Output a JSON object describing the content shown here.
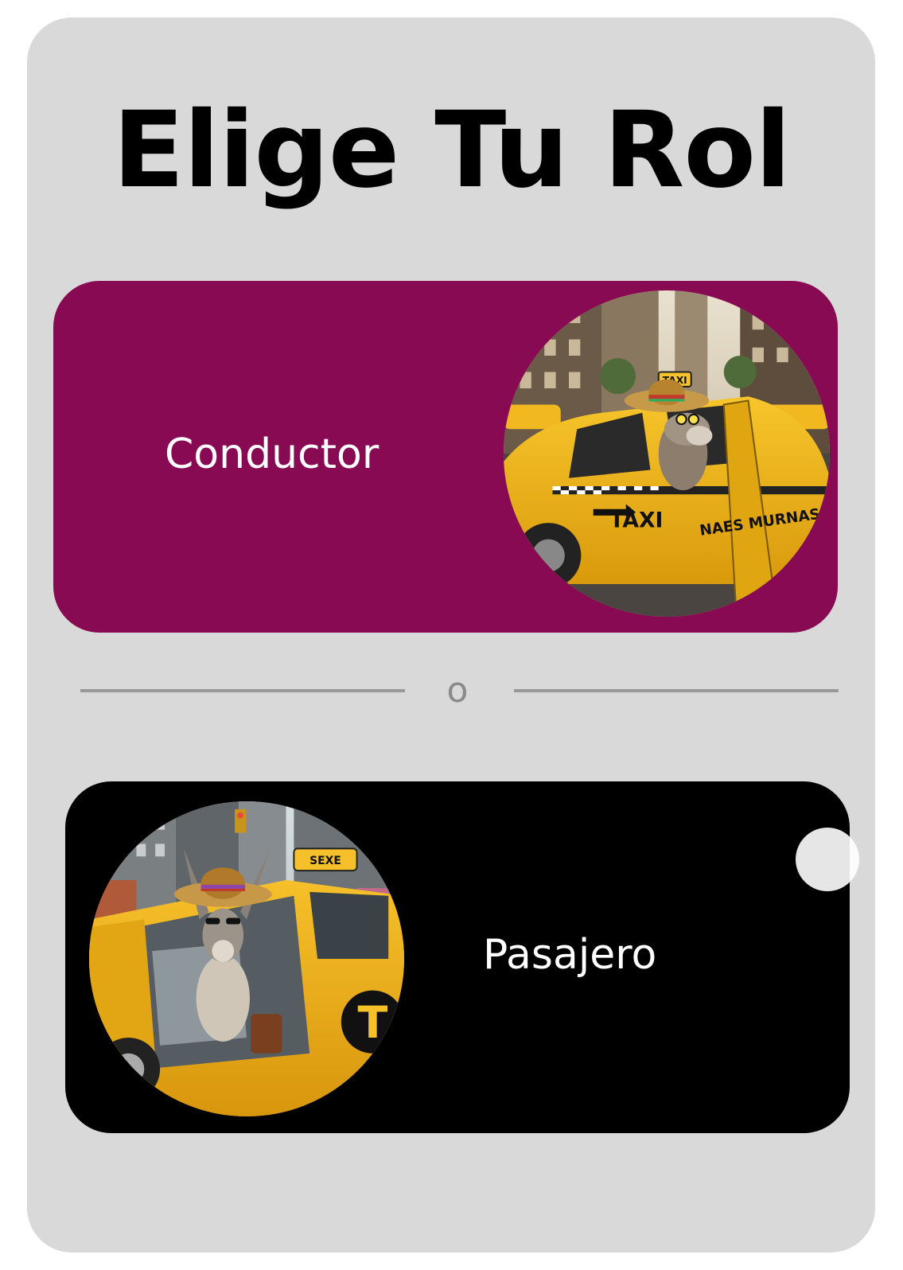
{
  "screen": {
    "title": "Elige Tu Rol",
    "separator_text": "o"
  },
  "roles": [
    {
      "label": "Conductor",
      "color": "#880a52",
      "image": "donkey-driving-taxi"
    },
    {
      "label": "Pasajero",
      "color": "#000000",
      "image": "donkey-passenger-in-taxi"
    }
  ],
  "illustration_text": {
    "driver_roof_sign": "TAXI",
    "driver_door_sign": "TAXI",
    "driver_door_text": "NAES MURNAS",
    "passenger_roof_sign": "SEXE",
    "passenger_door_letter": "T"
  }
}
